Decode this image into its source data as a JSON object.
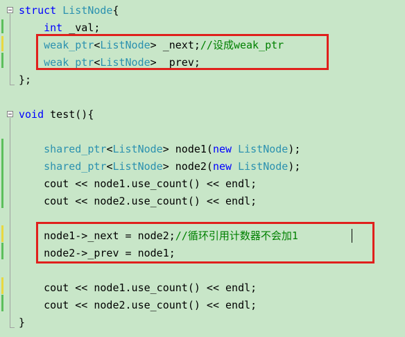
{
  "colors": {
    "background": "#c8e6c8",
    "keyword": "#0000ff",
    "type": "#2b91af",
    "comment": "#008000",
    "highlight_box": "#e0201c"
  },
  "lines": [
    {
      "tokens": [
        {
          "t": "kw",
          "v": "struct"
        },
        {
          "t": "id",
          "v": " "
        },
        {
          "t": "ty",
          "v": "ListNode"
        },
        {
          "t": "id",
          "v": "{"
        }
      ]
    },
    {
      "tokens": [
        {
          "t": "id",
          "v": "    "
        },
        {
          "t": "kw",
          "v": "int"
        },
        {
          "t": "id",
          "v": " _val;"
        }
      ]
    },
    {
      "tokens": [
        {
          "t": "id",
          "v": "    "
        },
        {
          "t": "ty",
          "v": "weak_ptr"
        },
        {
          "t": "id",
          "v": "<"
        },
        {
          "t": "ty",
          "v": "ListNode"
        },
        {
          "t": "id",
          "v": "> _next;"
        },
        {
          "t": "cm",
          "v": "//设成weak_ptr"
        }
      ]
    },
    {
      "tokens": [
        {
          "t": "id",
          "v": "    "
        },
        {
          "t": "ty",
          "v": "weak_ptr"
        },
        {
          "t": "id",
          "v": "<"
        },
        {
          "t": "ty",
          "v": "ListNode"
        },
        {
          "t": "id",
          "v": "> _prev;"
        }
      ]
    },
    {
      "tokens": [
        {
          "t": "id",
          "v": "};"
        }
      ]
    },
    {
      "tokens": [
        {
          "t": "id",
          "v": ""
        }
      ]
    },
    {
      "tokens": [
        {
          "t": "kw",
          "v": "void"
        },
        {
          "t": "id",
          "v": " test(){"
        }
      ]
    },
    {
      "tokens": [
        {
          "t": "id",
          "v": ""
        }
      ]
    },
    {
      "tokens": [
        {
          "t": "id",
          "v": "    "
        },
        {
          "t": "ty",
          "v": "shared_ptr"
        },
        {
          "t": "id",
          "v": "<"
        },
        {
          "t": "ty",
          "v": "ListNode"
        },
        {
          "t": "id",
          "v": "> node1("
        },
        {
          "t": "kw",
          "v": "new"
        },
        {
          "t": "id",
          "v": " "
        },
        {
          "t": "ty",
          "v": "ListNode"
        },
        {
          "t": "id",
          "v": ");"
        }
      ]
    },
    {
      "tokens": [
        {
          "t": "id",
          "v": "    "
        },
        {
          "t": "ty",
          "v": "shared_ptr"
        },
        {
          "t": "id",
          "v": "<"
        },
        {
          "t": "ty",
          "v": "ListNode"
        },
        {
          "t": "id",
          "v": "> node2("
        },
        {
          "t": "kw",
          "v": "new"
        },
        {
          "t": "id",
          "v": " "
        },
        {
          "t": "ty",
          "v": "ListNode"
        },
        {
          "t": "id",
          "v": ");"
        }
      ]
    },
    {
      "tokens": [
        {
          "t": "id",
          "v": "    cout << node1.use_count() << endl;"
        }
      ]
    },
    {
      "tokens": [
        {
          "t": "id",
          "v": "    cout << node2.use_count() << endl;"
        }
      ]
    },
    {
      "tokens": [
        {
          "t": "id",
          "v": ""
        }
      ]
    },
    {
      "tokens": [
        {
          "t": "id",
          "v": "    node1->_next = node2;"
        },
        {
          "t": "cm",
          "v": "//循环引用计数器不会加1"
        }
      ]
    },
    {
      "tokens": [
        {
          "t": "id",
          "v": "    node2->_prev = node1;"
        }
      ]
    },
    {
      "tokens": [
        {
          "t": "id",
          "v": ""
        }
      ]
    },
    {
      "tokens": [
        {
          "t": "id",
          "v": "    cout << node1.use_count() << endl;"
        }
      ]
    },
    {
      "tokens": [
        {
          "t": "id",
          "v": "    cout << node2.use_count() << endl;"
        }
      ]
    },
    {
      "tokens": [
        {
          "t": "id",
          "v": "}"
        }
      ]
    }
  ]
}
